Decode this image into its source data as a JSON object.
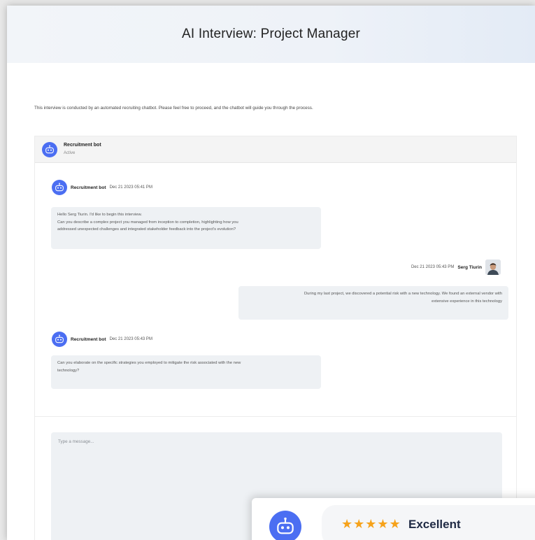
{
  "header": {
    "title": "AI Interview: Project Manager"
  },
  "intro_text": "This interview is conducted by an automated recruiting chatbot. Please feel free to proceed, and the chatbot will guide you through the process.",
  "chat": {
    "bot_name": "Recruitment bot",
    "bot_status": "Active",
    "messages": [
      {
        "sender": "Recruitment bot",
        "time": "Dec 21 2023 05:41 PM",
        "lines": [
          "Hello Serg Tiurin. I'd like to begin this interview.",
          "Can you describe a complex project you managed from inception to completion, highlighting how you",
          "addressed unexpected challenges and integrated stakeholder feedback into the project's evolution?"
        ]
      },
      {
        "sender": "Serg Tiurin",
        "time": "Dec 21 2023 05:43 PM",
        "lines": [
          "During my last project, we discovered a potential risk with a new technology. We found an external vendor with",
          "extensive experience in this technology"
        ]
      },
      {
        "sender": "Recruitment bot",
        "time": "Dec 21 2023 05:43 PM",
        "lines": [
          "Can you elaborate on the specific strategies you employed to mitigate the risk associated with the new",
          "technology?"
        ]
      }
    ],
    "input_placeholder": "Type a message..."
  },
  "rating": {
    "stars": 5,
    "label": "Excellent",
    "star_color": "#f6a21a"
  },
  "icons": {
    "bot_avatar": "robot-icon",
    "star": "star-icon"
  },
  "colors": {
    "bot_avatar_bg": "#4b6ef2",
    "bubble_bg": "#eef1f4"
  }
}
